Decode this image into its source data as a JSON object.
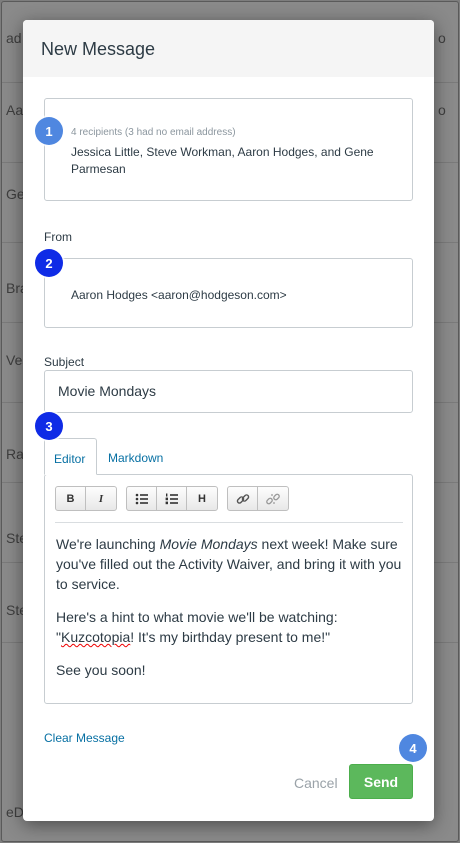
{
  "background": {
    "left_fragments": [
      "ad",
      "Aa",
      "Ge",
      "Bra",
      "Ves",
      "Rai",
      "Ste",
      "Ste",
      "eD"
    ],
    "right_fragments": [
      "o",
      "o"
    ]
  },
  "modal": {
    "title": "New Message",
    "recipients": {
      "count_text": "4 recipients (3 had no email address)",
      "names": "Jessica Little, Steve Workman, Aaron Hodges, and Gene Parmesan"
    },
    "from": {
      "label": "From",
      "value": "Aaron Hodges <aaron@hodgeson.com>"
    },
    "subject": {
      "label": "Subject",
      "value": "Movie Mondays"
    },
    "tabs": [
      {
        "label": "Editor",
        "active": true
      },
      {
        "label": "Markdown",
        "active": false
      }
    ],
    "toolbar": {
      "bold": "B",
      "italic": "I",
      "heading": "H"
    },
    "body": {
      "p1_before": "We're launching ",
      "p1_em": "Movie Mondays",
      "p1_after": " next week! Make sure you've filled out the Activity Waiver, and bring it with you to service.",
      "p2_before": "Here's a hint to what movie we'll be watching: \"",
      "p2_misspelled": "Kuzcotopia",
      "p2_after": "! It's my birthday present to me!\"",
      "p3": "See you soon!"
    },
    "clear_label": "Clear Message",
    "cancel_label": "Cancel",
    "send_label": "Send"
  },
  "callouts": [
    "1",
    "2",
    "3",
    "4"
  ],
  "colors": {
    "link": "#0770a3",
    "send_button": "#5cb85c",
    "callout_light": "#4f87e0",
    "callout_dark": "#0f2be6"
  }
}
